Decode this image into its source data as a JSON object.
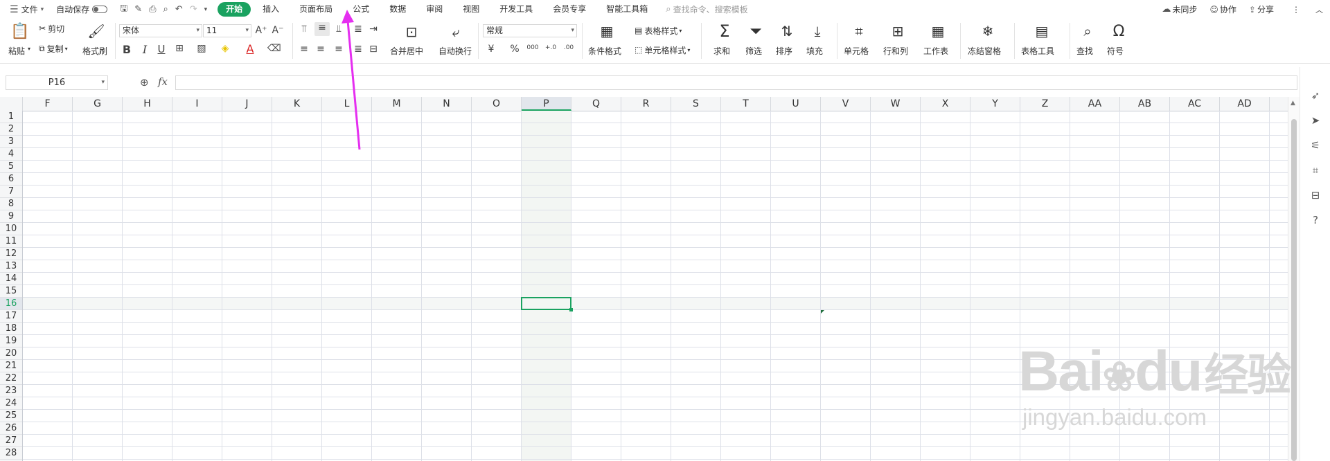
{
  "menubar": {
    "items": [
      {
        "name": "file-menu",
        "label": "文件"
      },
      {
        "name": "autosave-label",
        "label": "自动保存"
      }
    ],
    "tabs": [
      "开始",
      "插入",
      "页面布局",
      "公式",
      "数据",
      "审阅",
      "视图",
      "开发工具",
      "会员专享",
      "智能工具箱"
    ],
    "active_tab": "开始",
    "search_placeholder": "查找命令、搜索模板",
    "right": [
      {
        "name": "unsync-button",
        "label": "未同步"
      },
      {
        "name": "collaborate-button",
        "label": "协作"
      },
      {
        "name": "share-button",
        "label": "分享"
      }
    ]
  },
  "ribbon": {
    "paste": "粘贴",
    "cut": "剪切",
    "copy": "复制",
    "format_painter": "格式刷",
    "font_name": "宋体",
    "font_size": "11",
    "merge_center": "合并居中",
    "wrap_text": "自动换行",
    "number_format": "常规",
    "conditional_format": "条件格式",
    "table_style": "表格样式",
    "cell_style": "单元格样式",
    "sum": "求和",
    "filter": "筛选",
    "sort": "排序",
    "fill": "填充",
    "cell": "单元格",
    "row_col": "行和列",
    "worksheet": "工作表",
    "freeze_panes": "冻结窗格",
    "table_tools": "表格工具",
    "find": "查找",
    "symbol": "符号",
    "currency_symbol": "¥",
    "percent_symbol": "%",
    "thousands_symbol": "000",
    "decimal_increase": "+.0",
    "decimal_decrease": ".00"
  },
  "formulabar": {
    "name_box": "P16",
    "fx_label": "fx",
    "formula": ""
  },
  "grid": {
    "columns": [
      "F",
      "G",
      "H",
      "I",
      "J",
      "K",
      "L",
      "M",
      "N",
      "O",
      "P",
      "Q",
      "R",
      "S",
      "T",
      "U",
      "V",
      "W",
      "X",
      "Y",
      "Z",
      "AA",
      "AB",
      "AC",
      "AD"
    ],
    "selected_column": "P",
    "rows": [
      "1",
      "2",
      "3",
      "4",
      "5",
      "6",
      "7",
      "8",
      "9",
      "10",
      "11",
      "12",
      "13",
      "14",
      "15",
      "16",
      "17",
      "18",
      "19",
      "20",
      "21",
      "22",
      "23",
      "24",
      "25",
      "26",
      "27",
      "28"
    ],
    "selected_row": "16"
  },
  "watermark": {
    "brand": "Bai",
    "brand_du": "du",
    "cn": "经验",
    "url": "jingyan.baidu.com"
  },
  "colors": {
    "accent": "#1aa260",
    "annotation_arrow": "#e52ef0"
  }
}
